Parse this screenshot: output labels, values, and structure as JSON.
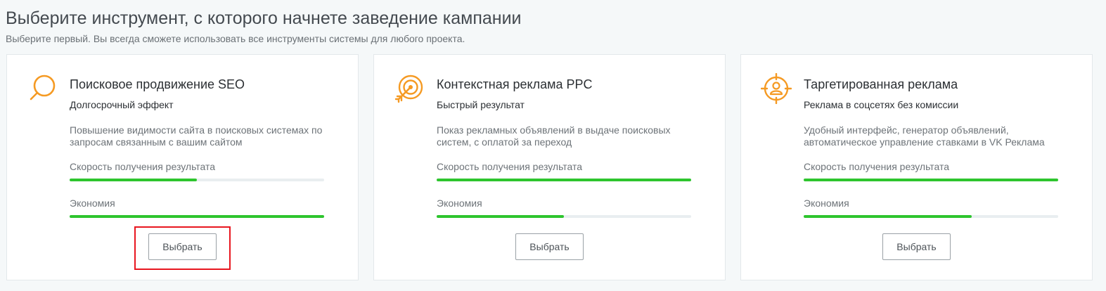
{
  "header": {
    "title": "Выберите инструмент, с которого начнете заведение кампании",
    "subtitle": "Выберите первый. Вы всегда сможете использовать все инструменты системы для любого проекта."
  },
  "colors": {
    "accent": "#f59a23",
    "progress": "#2ec52e",
    "track": "#e9eef0",
    "highlight": "#e8161f"
  },
  "cards": [
    {
      "icon": "search-icon",
      "title": "Поисковое продвижение SEO",
      "tagline": "Долгосрочный эффект",
      "description": "Повышение видимости сайта в поисковых системах по запросам связанным с вашим сайтом",
      "speed_label": "Скорость получения результата",
      "speed_level": 0.5,
      "economy_label": "Экономия",
      "economy_level": 1.0,
      "button_label": "Выбрать",
      "highlighted": true
    },
    {
      "icon": "target-arrow-icon",
      "title": "Контекстная реклама PPC",
      "tagline": "Быстрый результат",
      "description": "Показ рекламных объявлений в выдаче поисковых систем, с оплатой за переход",
      "speed_label": "Скорость получения результата",
      "speed_level": 1.0,
      "economy_label": "Экономия",
      "economy_level": 0.5,
      "button_label": "Выбрать",
      "highlighted": false
    },
    {
      "icon": "crosshair-user-icon",
      "title": "Таргетированная реклама",
      "tagline": "Реклама в соцсетях без комиссии",
      "description": "Удобный интерфейс, генератор объявлений, автоматическое управление ставками в VK Реклама",
      "speed_label": "Скорость получения результата",
      "speed_level": 1.0,
      "economy_label": "Экономия",
      "economy_level": 0.66,
      "button_label": "Выбрать",
      "highlighted": false
    }
  ]
}
